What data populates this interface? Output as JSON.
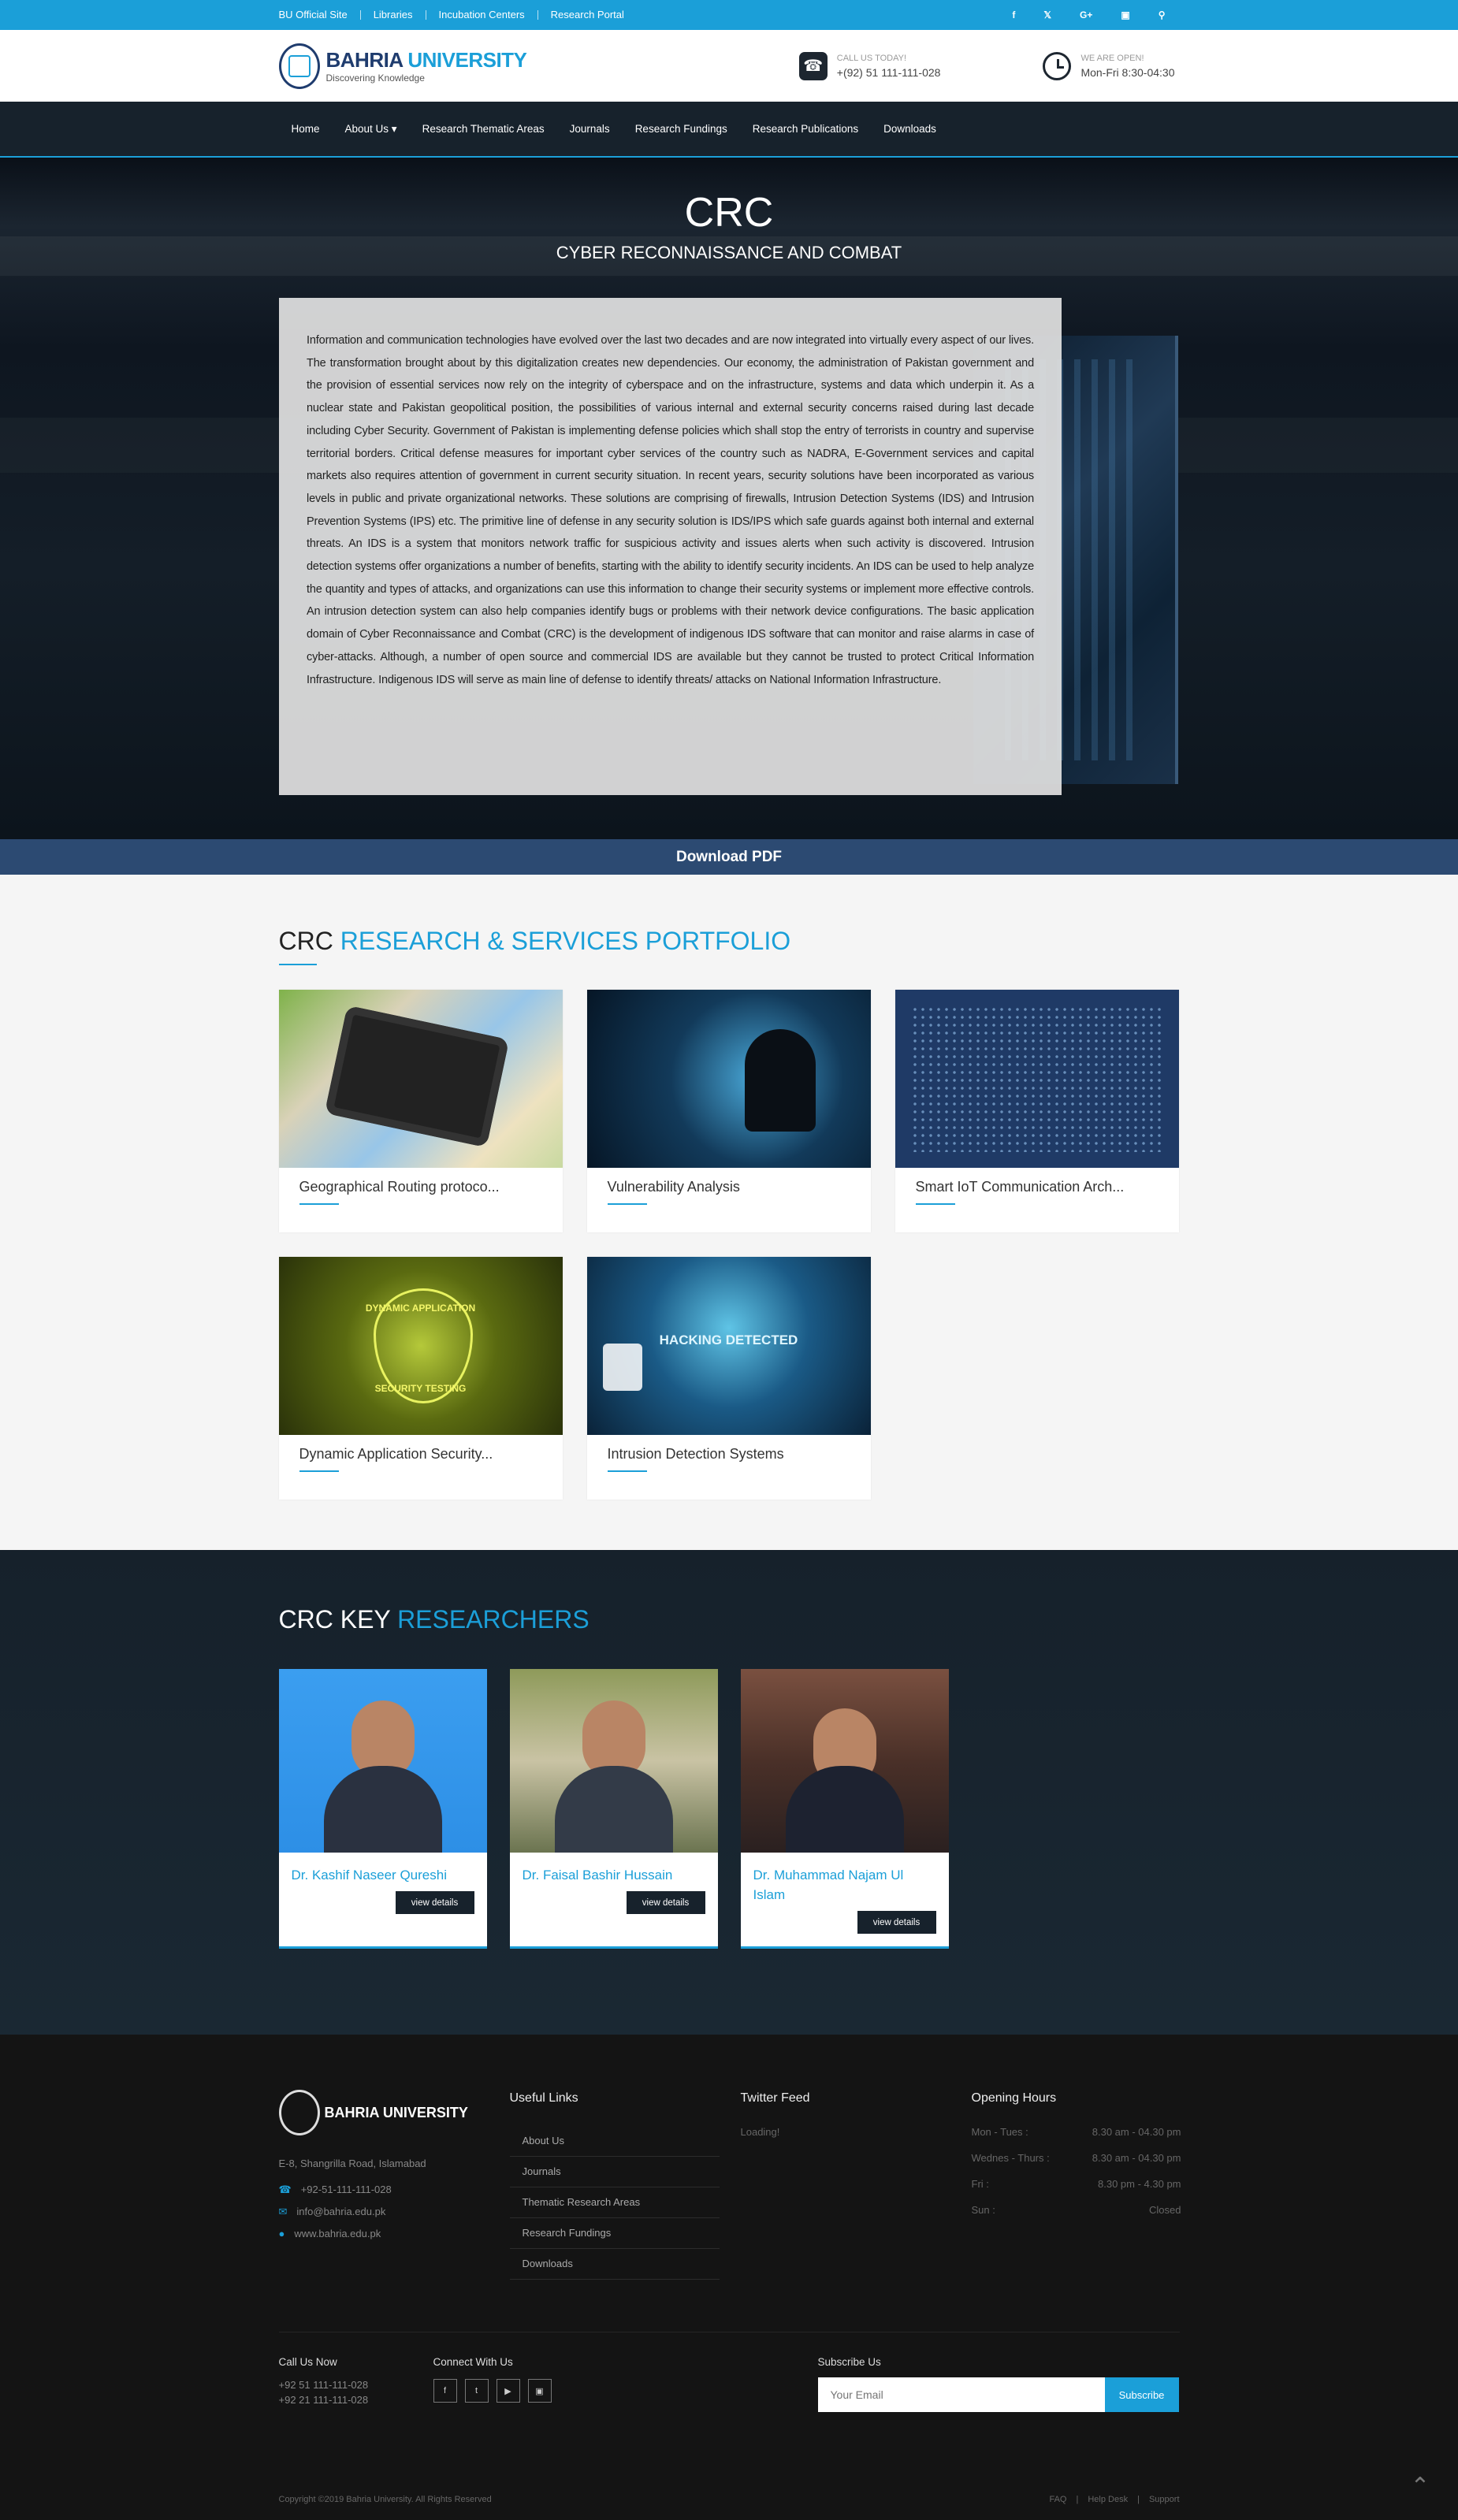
{
  "topbar": {
    "links": [
      "BU Official Site",
      "Libraries",
      "Incubation Centers",
      "Research Portal"
    ],
    "social": [
      "f",
      "t",
      "G+",
      "ig",
      "search"
    ]
  },
  "header": {
    "brand1": "BAHRIA",
    "brand2": "UNIVERSITY",
    "tagline": "Discovering Knowledge",
    "call_label": "CALL US TODAY!",
    "call_value": "+(92) 51 111-111-028",
    "open_label": "WE ARE OPEN!",
    "open_value": "Mon-Fri 8:30-04:30"
  },
  "nav": [
    "Home",
    "About Us ▾",
    "Research Thematic Areas",
    "Journals",
    "Research Fundings",
    "Research Publications",
    "Downloads"
  ],
  "hero": {
    "title": "CRC",
    "subtitle": "CYBER RECONNAISSANCE AND COMBAT",
    "body": "Information and communication technologies have evolved over the last two decades and are now integrated into virtually every aspect of our lives. The transformation brought about by this digitalization creates new dependencies. Our economy, the administration of Pakistan government and the provision of essential services now rely on the integrity of cyberspace and on the infrastructure, systems and data which underpin it. As a nuclear state and Pakistan geopolitical position, the possibilities of various internal and external security concerns raised during last decade including Cyber Security. Government of Pakistan is implementing defense policies which shall stop the entry of terrorists in country and supervise territorial borders. Critical defense measures for important cyber services of the country such as NADRA, E-Government services and capital markets also requires attention of government in current security situation. In recent years, security solutions have been incorporated as various levels in public and private organizational networks. These solutions are comprising of firewalls, Intrusion Detection Systems (IDS) and Intrusion Prevention Systems (IPS) etc. The primitive line of defense in any security solution is IDS/IPS which safe guards against both internal and external threats. An IDS is a system that monitors network traffic for suspicious activity and issues alerts when such activity is discovered. Intrusion detection systems offer organizations a number of benefits, starting with the ability to identify security incidents. An IDS can be used to help analyze the quantity and types of attacks, and organizations can use this information to change their security systems or implement more effective controls. An intrusion detection system can also help companies identify bugs or problems with their network device configurations. The basic application domain of Cyber Reconnaissance and Combat (CRC) is the development of indigenous IDS software that can monitor and raise alarms in case of cyber-attacks. Although, a number of open source and commercial IDS are available but they cannot be trusted to protect Critical Information Infrastructure. Indigenous IDS will serve as main line of defense to identify threats/ attacks on National Information Infrastructure."
  },
  "download": "Download PDF",
  "portfolio": {
    "title1": "CRC",
    "title2": "RESEARCH & SERVICES PORTFOLIO",
    "items": [
      "Geographical Routing protoco...",
      "Vulnerability Analysis",
      "Smart IoT Communication Arch...",
      "Dynamic Application Security...",
      "Intrusion Detection Systems"
    ],
    "img4_top": "DYNAMIC APPLICATION",
    "img4_bottom": "SECURITY TESTING",
    "img5_text": "HACKING DETECTED"
  },
  "researchers": {
    "title1": "CRC KEY",
    "title2": "RESEARCHERS",
    "people": [
      "Dr. Kashif Naseer Qureshi",
      "Dr. Faisal Bashir Hussain",
      "Dr. Muhammad Najam Ul Islam"
    ],
    "button": "view details"
  },
  "footer": {
    "brand": "BAHRIA UNIVERSITY",
    "address": "E-8, Shangrilla Road, Islamabad",
    "phone": "+92-51-111-111-028",
    "email": "info@bahria.edu.pk",
    "web": "www.bahria.edu.pk",
    "useful_title": "Useful Links",
    "links": [
      "About Us",
      "Journals",
      "Thematic Research Areas",
      "Research Fundings",
      "Downloads"
    ],
    "twitter_title": "Twitter Feed",
    "twitter_loading": "Loading!",
    "hours_title": "Opening Hours",
    "hours": [
      [
        "Mon - Tues :",
        "8.30 am - 04.30 pm"
      ],
      [
        "Wednes - Thurs :",
        "8.30 am - 04.30 pm"
      ],
      [
        "Fri :",
        "8.30 pm - 4.30 pm"
      ],
      [
        "Sun :",
        "Closed"
      ]
    ],
    "call_title": "Call Us Now",
    "call1": "+92 51 111-111-028",
    "call2": "+92 21 111-111-028",
    "connect_title": "Connect With Us",
    "subscribe_title": "Subscribe Us",
    "email_placeholder": "Your Email",
    "subscribe_btn": "Subscribe",
    "copyright": "Copyright ©2019 Bahria University. All Rights Reserved",
    "bottom_links": [
      "FAQ",
      "|",
      "Help Desk",
      "|",
      "Support"
    ]
  }
}
